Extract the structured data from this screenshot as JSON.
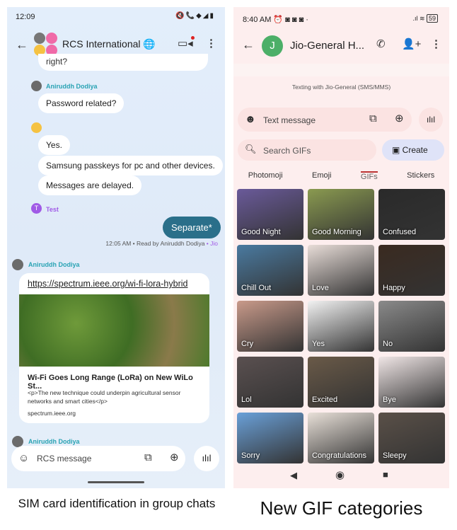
{
  "left": {
    "status_time": "12:09",
    "title": "RCS International",
    "messages": [
      {
        "text": "right?"
      },
      {
        "sender": "Aniruddh Dodiya",
        "text": "Password related?"
      },
      {
        "text": "Yes."
      },
      {
        "text": "Samsung passkeys for pc and other devices."
      },
      {
        "text": "Messages are delayed."
      }
    ],
    "test_sender": "Test",
    "test_initial": "T",
    "outgoing": "Separate*",
    "receipt": "12:05 AM • Read by Aniruddh Dodiya",
    "receipt_carrier": "• Jio",
    "link_sender": "Aniruddh Dodiya",
    "link_url": "https://spectrum.ieee.org/wi-fi-lora-hybrid",
    "link_title": "Wi-Fi Goes Long Range (LoRa) on New WiLo St...",
    "link_desc": "<p>The new technique could underpin agricultural sensor networks and smart cities</p>",
    "link_domain": "spectrum.ieee.org",
    "next_sender": "Aniruddh Dodiya",
    "composer_placeholder": "RCS message",
    "accent": "#2a6f8a"
  },
  "right": {
    "status_time": "8:40 AM",
    "battery": "59",
    "contact_initial": "J",
    "contact_name": "Jio-General H...",
    "texting_with": "Texting with Jio-General (SMS/MMS)",
    "composer_placeholder": "Text message",
    "search_placeholder": "Search GIFs",
    "create_label": "Create",
    "tabs": [
      "Photomoji",
      "Emoji",
      "GIFs",
      "Stickers"
    ],
    "active_tab": "GIFs",
    "gifs": [
      "Good Night",
      "Good Morning",
      "Confused",
      "Chill Out",
      "Love",
      "Happy",
      "Cry",
      "Yes",
      "No",
      "Lol",
      "Excited",
      "Bye",
      "Sorry",
      "Congratulations",
      "Sleepy"
    ],
    "accent": "#4caf68"
  },
  "captions": {
    "left": "SIM card identification in group chats",
    "right": "New GIF categories"
  }
}
